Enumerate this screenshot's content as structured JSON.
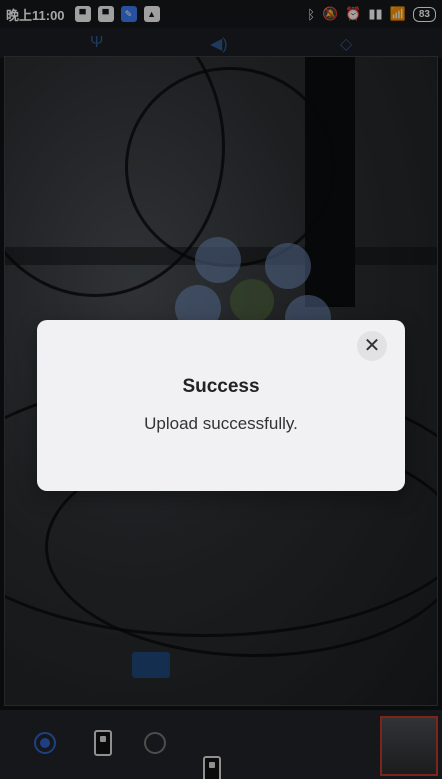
{
  "status_bar": {
    "time": "晚上11:00",
    "battery": "83",
    "app_icons": [
      "app-icon-1",
      "app-icon-2",
      "app-icon-3",
      "app-icon-4"
    ],
    "indicator_icons": [
      "bluetooth-icon",
      "mute-icon",
      "alarm-icon",
      "signal-icon",
      "wifi-icon"
    ]
  },
  "dialog": {
    "title": "Success",
    "message": "Upload successfully.",
    "close_icon": "close-icon"
  },
  "bottom_toolbar": {
    "items": [
      {
        "name": "radio-option-1",
        "selected": true
      },
      {
        "name": "device-icon-1"
      },
      {
        "name": "radio-option-2",
        "selected": false
      },
      {
        "name": "device-icon-2"
      }
    ]
  },
  "colors": {
    "accent": "#2e63c8",
    "dialog_bg": "#f1f1f3",
    "toolbar_bg": "#222428"
  }
}
